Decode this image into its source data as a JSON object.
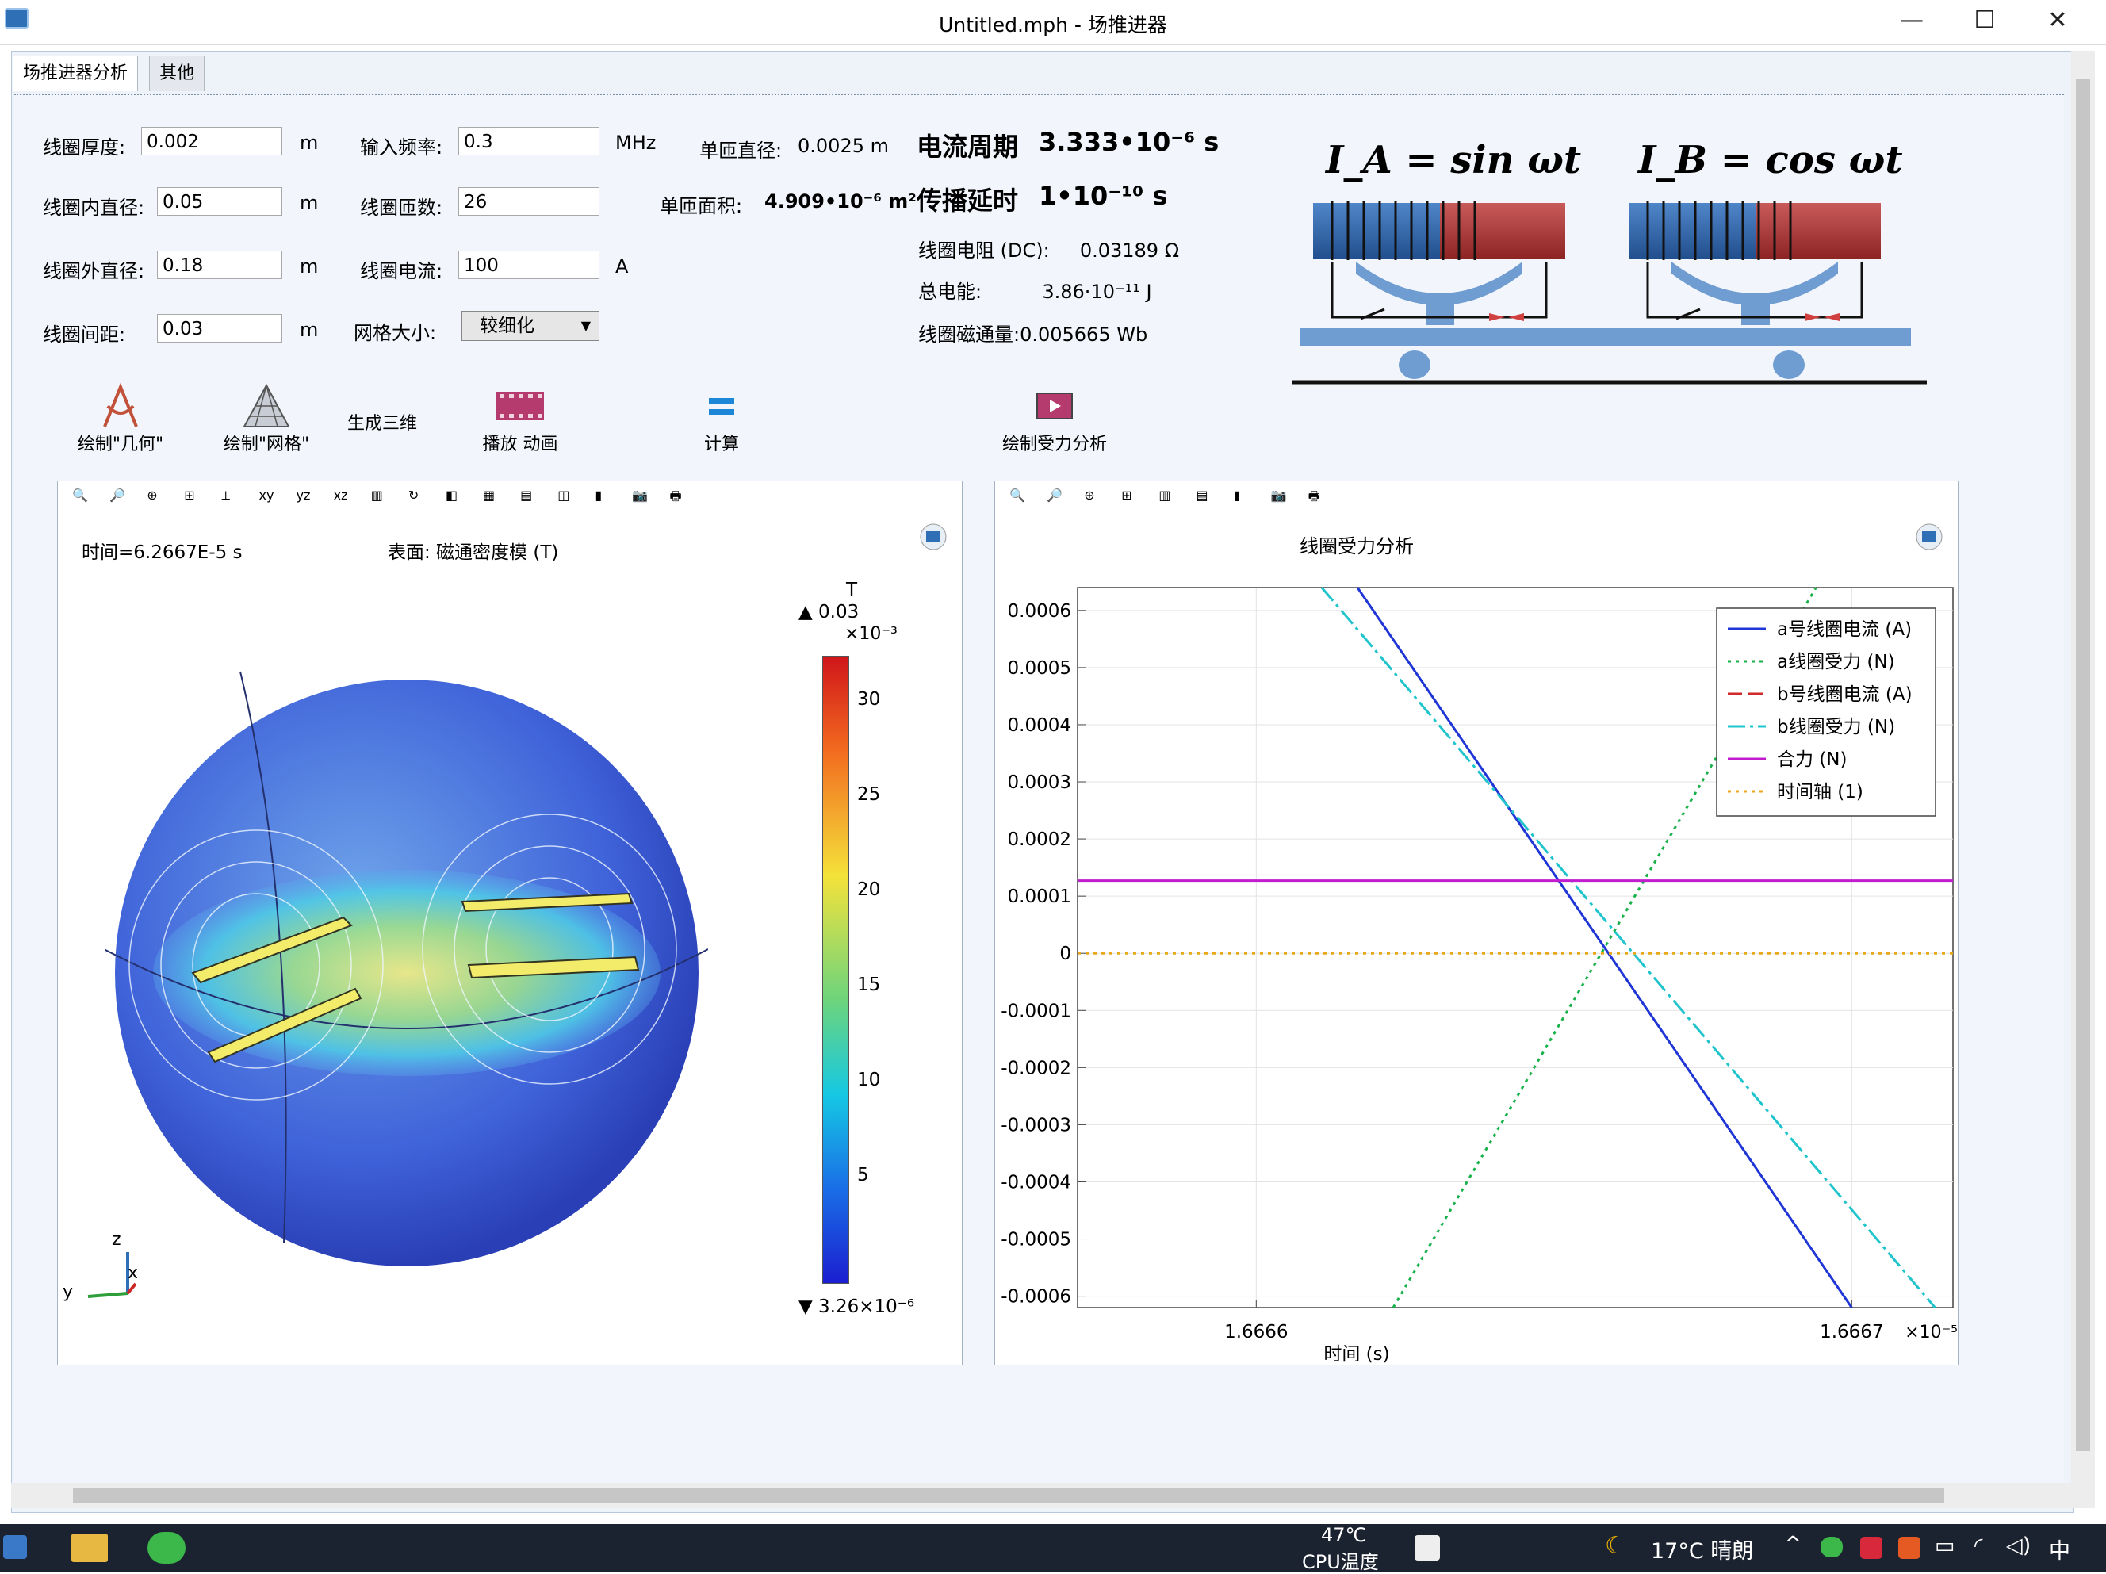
{
  "window": {
    "title": "Untitled.mph - 场推进器"
  },
  "tabs": [
    {
      "label": "场推进器分析"
    },
    {
      "label": "其他"
    }
  ],
  "form": {
    "thickness": {
      "label": "线圈厚度:",
      "value": "0.002",
      "unit": "m"
    },
    "inner_d": {
      "label": "线圈内直径:",
      "value": "0.05",
      "unit": "m"
    },
    "outer_d": {
      "label": "线圈外直径:",
      "value": "0.18",
      "unit": "m"
    },
    "spacing": {
      "label": "线圈间距:",
      "value": "0.03",
      "unit": "m"
    },
    "freq": {
      "label": "输入频率:",
      "value": "0.3",
      "unit": "MHz"
    },
    "turns": {
      "label": "线圈匝数:",
      "value": "26"
    },
    "current": {
      "label": "线圈电流:",
      "value": "100",
      "unit": "A"
    },
    "mesh": {
      "label": "网格大小:",
      "selected": "较细化"
    }
  },
  "results": {
    "wire_d_label": "单匝直径:",
    "wire_d_value": "0.0025 m",
    "wire_area_label": "单匝面积:",
    "wire_area_value": "4.909•10⁻⁶ m²",
    "period_label": "电流周期",
    "period_value": "3.333•10⁻⁶ s",
    "delay_label": "传播延时",
    "delay_value": "1•10⁻¹⁰ s",
    "resistance": "线圈电阻 (DC):     0.03189 Ω",
    "energy": "总电能:          3.86·10⁻¹¹ J",
    "flux": "线圈磁通量:0.005665 Wb"
  },
  "diagram": {
    "eqA": "I_A = sin ωt",
    "eqB": "I_B = cos ωt"
  },
  "buttons": {
    "geom": "绘制\"几何\"",
    "mesh": "绘制\"网格\"",
    "gen3d": "生成三维",
    "anim": "播放 动画",
    "calc": "计算",
    "force": "绘制受力分析"
  },
  "plot3d": {
    "time": "时间=6.2667E-5 s",
    "surface": "表面: 磁通密度模 (T)",
    "cb_unit": "T",
    "cb_max": "0.03",
    "cb_exp": "×10⁻³",
    "cb_ticks": [
      "30",
      "25",
      "20",
      "15",
      "10",
      "5"
    ],
    "cb_min": "3.26×10⁻⁶",
    "axes": {
      "z": "z",
      "x": "x",
      "y": "y"
    }
  },
  "chart_data": {
    "type": "line",
    "title": "线圈受力分析",
    "xlabel": "时间 (s)",
    "x_exponent": "×10⁻⁵",
    "ylim": [
      -0.00062,
      0.00064
    ],
    "xlim": [
      1.66657,
      1.666717
    ],
    "ytick_labels": [
      "0.0006",
      "0.0005",
      "0.0004",
      "0.0003",
      "0.0002",
      "0.0001",
      "0",
      "-0.0001",
      "-0.0002",
      "-0.0003",
      "-0.0004",
      "-0.0005",
      "-0.0006"
    ],
    "ytick_values": [
      0.0006,
      0.0005,
      0.0004,
      0.0003,
      0.0002,
      0.0001,
      0,
      -0.0001,
      -0.0002,
      -0.0003,
      -0.0004,
      -0.0005,
      -0.0006
    ],
    "xtick_labels": [
      "1.6666",
      "1.6667"
    ],
    "xtick_values": [
      1.6666,
      1.6667
    ],
    "legend_position": "top-right",
    "series": [
      {
        "name": "a号线圈电流 (A)",
        "color": "#1f35d6",
        "dash": "none",
        "x": [
          1.666617,
          1.6667
        ],
        "y": [
          0.00064,
          -0.00062
        ]
      },
      {
        "name": "a线圈受力 (N)",
        "color": "#19b24a",
        "dash": "4 6",
        "x": [
          1.666623,
          1.666694
        ],
        "y": [
          -0.00062,
          0.00064
        ]
      },
      {
        "name": "b号线圈电流 (A)",
        "color": "#d12a2a",
        "dash": "18 8",
        "x": [],
        "y": []
      },
      {
        "name": "b线圈受力 (N)",
        "color": "#20c4cc",
        "dash": "22 6 4 6",
        "x": [
          1.666611,
          1.666714
        ],
        "y": [
          0.00064,
          -0.00062
        ]
      },
      {
        "name": "合力 (N)",
        "color": "#c21ccf",
        "dash": "none",
        "x": [
          1.66657,
          1.666717
        ],
        "y": [
          0.000127,
          0.000127
        ]
      },
      {
        "name": "时间轴 (1)",
        "color": "#e8a81a",
        "dash": "4 6",
        "x": [
          1.66657,
          1.666717
        ],
        "y": [
          0,
          0
        ]
      }
    ]
  },
  "taskbar": {
    "cpu_temp": "47℃",
    "cpu_label": "CPU温度",
    "weather": "17°C  晴朗",
    "ime": "中"
  },
  "colors": {
    "accent": "#2f6fb5",
    "panel_bg": "#f2f6fc",
    "taskbar": "#1c2330"
  }
}
